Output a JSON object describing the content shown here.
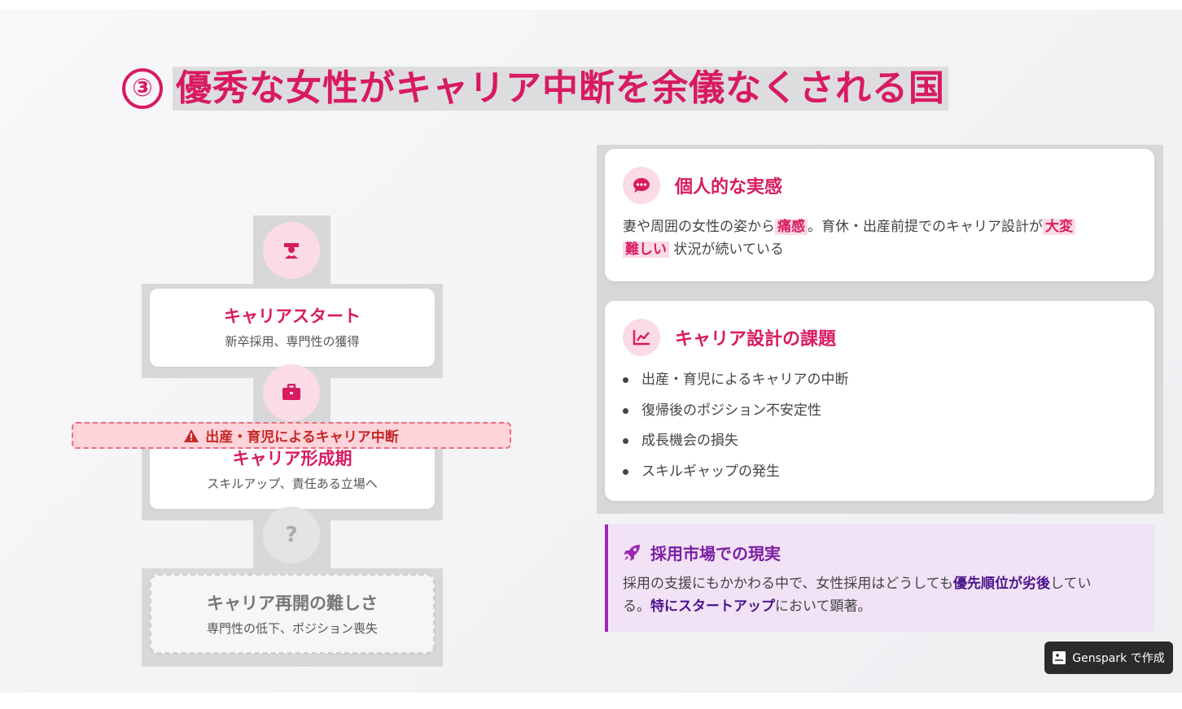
{
  "title": {
    "number": "③",
    "text": "優秀な女性がキャリア中断を余儀なくされる国"
  },
  "timeline": {
    "stages": [
      {
        "title": "キャリアスタート",
        "subtitle": "新卒採用、専門性の獲得",
        "icon": "graduate-icon"
      },
      {
        "title": "キャリア形成期",
        "subtitle": "スキルアップ、責任ある立場へ",
        "icon": "briefcase-icon"
      },
      {
        "title": "キャリア再開の難しさ",
        "subtitle": "専門性の低下、ポジション喪失",
        "icon": "question-icon",
        "icon_text": "?"
      }
    ],
    "warning": "出産・育児によるキャリア中断"
  },
  "personal_card": {
    "title": "個人的な実感",
    "text_1": "妻や周囲の女性の姿から",
    "highlight_1": "痛感",
    "text_2": "。育休・出産前提でのキャリア設計が",
    "highlight_2a": "大変",
    "highlight_2b": "難しい",
    "text_3": "状況が続いている"
  },
  "issues_card": {
    "title": "キャリア設計の課題",
    "items": [
      "出産・育児によるキャリアの中断",
      "復帰後のポジション不安定性",
      "成長機会の損失",
      "スキルギャップの発生"
    ]
  },
  "market_card": {
    "title": "採用市場での現実",
    "text_1": "採用の支援にもかかわる中で、女性採用はどうしても",
    "bold_1": "優先順位が劣後",
    "text_2": "してい",
    "text_3": "る。",
    "bold_2": "特にスタートアップ",
    "text_4": "において顕著。"
  },
  "badge": {
    "label": "Genspark で作成"
  },
  "colors": {
    "accent": "#d81b60",
    "purple": "#9c27b0",
    "warning": "#c62828"
  }
}
